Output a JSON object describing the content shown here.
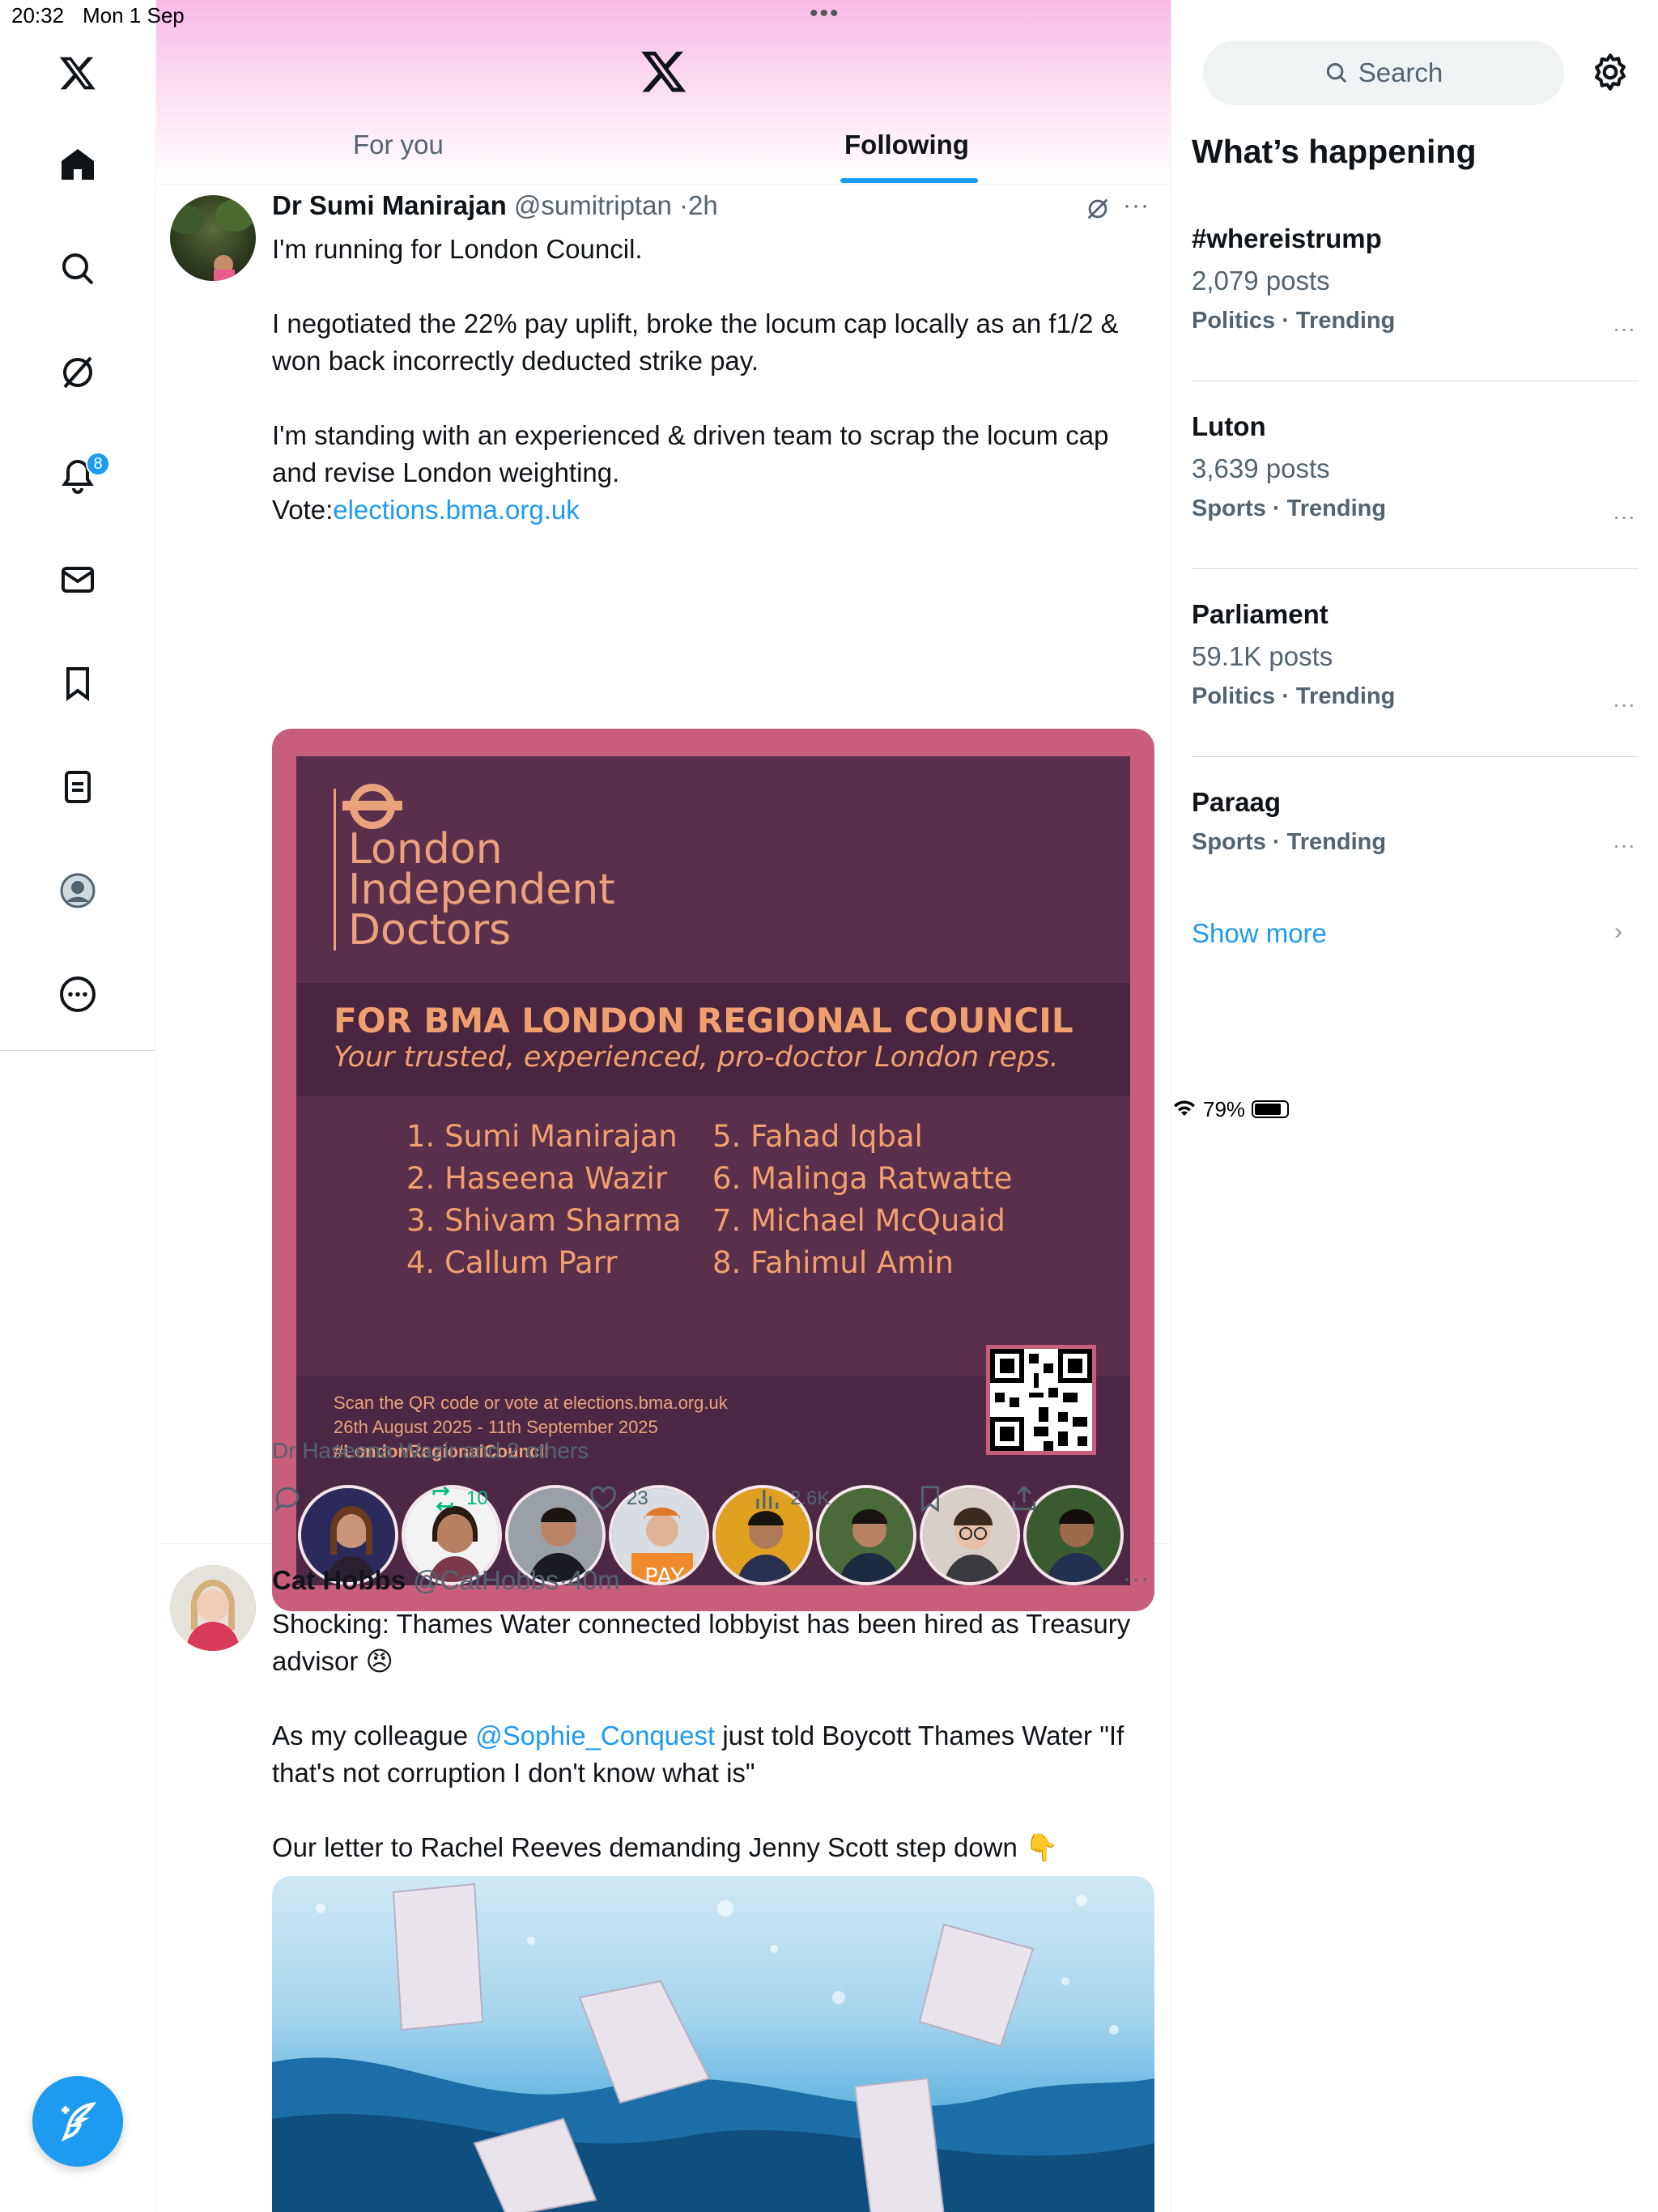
{
  "status_bar": {
    "time": "20:32",
    "date": "Mon 1 Sep",
    "battery": "79%"
  },
  "nav": {
    "items": [
      "Home",
      "Explore",
      "Grok",
      "Notifications",
      "Messages",
      "Bookmarks",
      "Lists",
      "Profile",
      "More"
    ],
    "notifications_badge": "8"
  },
  "header": {
    "tabs": [
      {
        "label": "For you",
        "active": false
      },
      {
        "label": "Following",
        "active": true
      }
    ]
  },
  "tweets": [
    {
      "name": "Dr Sumi Manirajan",
      "handle": "@sumitriptan",
      "time": "2h",
      "text": [
        "I'm running for London Council.",
        "",
        "I negotiated the 22% pay uplift, broke the locum cap locally as an f1/2 & won back incorrectly deducted strike pay.",
        "",
        "I'm standing with an experienced & driven team to scrap the locum cap and revise London weighting."
      ],
      "vote_label": "Vote:",
      "vote_link": "elections.bma.org.uk",
      "poster": {
        "org_line1": "London",
        "org_line2": "Independent",
        "org_line3": "Doctors",
        "title": "FOR BMA LONDON REGIONAL COUNCIL",
        "subtitle": "Your trusted, experienced, pro-doctor London reps.",
        "candidates_left": [
          "1. Sumi Manirajan",
          "2. Haseena Wazir",
          "3. Shivam Sharma",
          "4. Callum Parr"
        ],
        "candidates_right": [
          "5. Fahad Iqbal",
          "6. Malinga Ratwatte",
          "7. Michael McQuaid",
          "8. Fahimul Amin"
        ],
        "footer_line1": "Scan the QR code or vote at elections.bma.org.uk",
        "footer_line2": "26th August 2025 - 11th September 2025",
        "footer_tag": "#LondonRegionalCouncil"
      },
      "liked_by": "Dr Haseena Wazir and 2 others",
      "stats": {
        "replies": "",
        "retweets": "10",
        "likes": "23",
        "views": "2.6K"
      }
    },
    {
      "name": "Cat Hobbs",
      "handle": "@CatHobbs",
      "time": "40m",
      "text_line1": "Shocking: Thames Water connected lobbyist has been hired as Treasury advisor 😠",
      "text_line2_pre": "As my colleague ",
      "text_line2_mention": "@Sophie_Conquest",
      "text_line2_post": " just told Boycott Thames Water \"If that's not corruption I don't know what is\"",
      "text_line3": "Our letter to Rachel Reeves demanding Jenny Scott step down 👇"
    }
  ],
  "sidebar": {
    "search_placeholder": "Search",
    "whats_happening": "What’s happening",
    "trends": [
      {
        "name": "#whereistrump",
        "count": "2,079 posts",
        "category": "Politics · Trending"
      },
      {
        "name": "Luton",
        "count": "3,639 posts",
        "category": "Sports · Trending"
      },
      {
        "name": "Parliament",
        "count": "59.1K posts",
        "category": "Politics · Trending"
      },
      {
        "name": "Paraag",
        "count": "",
        "category": "Sports · Trending"
      }
    ],
    "show_more": "Show more"
  },
  "colors": {
    "accent": "#1d9bf0",
    "retweet": "#00ba7c",
    "poster_bg": "#5a2f4b",
    "poster_frame": "#c95e7c",
    "poster_text": "#f0a06e"
  }
}
